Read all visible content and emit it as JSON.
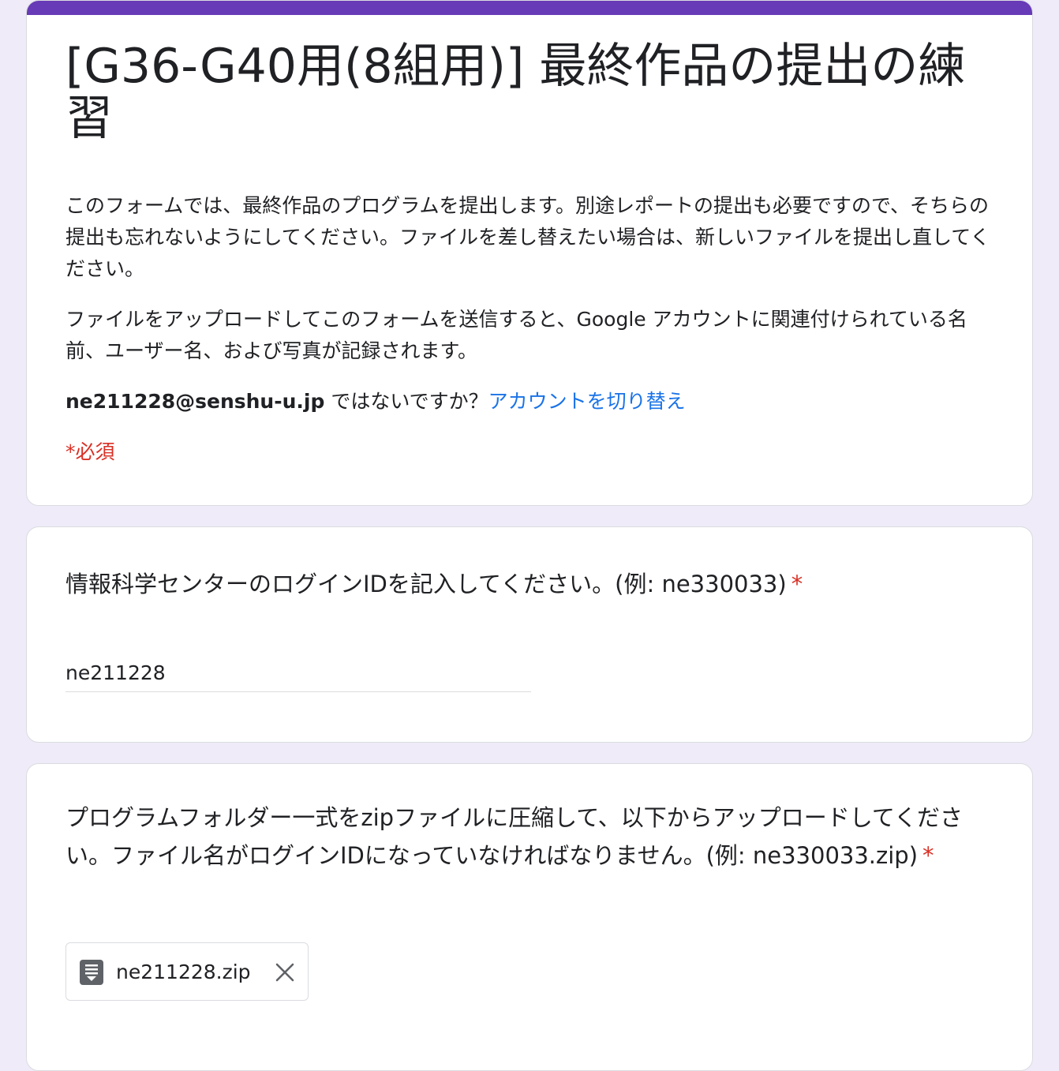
{
  "form": {
    "title": "[G36-G40用(8組用)] 最終作品の提出の練習",
    "description_1": "このフォームでは、最終作品のプログラムを提出します。別途レポートの提出も必要ですので、そちらの提出も忘れないようにしてください。ファイルを差し替えたい場合は、新しいファイルを提出し直してください。",
    "description_2": "ファイルをアップロードしてこのフォームを送信すると、Google アカウントに関連付けられている名前、ユーザー名、および写真が記録されます。",
    "account_email": "ne211228@senshu-u.jp",
    "account_question": " ではないですか？",
    "switch_account_label": "アカウントを切り替え",
    "required_note": "*必須",
    "accent_color": "#673ab7",
    "required_color": "#d93025",
    "link_color": "#1a73e8"
  },
  "questions": [
    {
      "label": "情報科学センターのログインIDを記入してください。(例: ne330033)",
      "required_mark": "*",
      "answer_value": "ne211228"
    },
    {
      "label": "プログラムフォルダー一式をzipファイルに圧縮して、以下からアップロードしてください。ファイル名がログインIDになっていなければなりません。(例: ne330033.zip)",
      "required_mark": "*",
      "uploaded_file": {
        "name": "ne211228.zip",
        "icon": "archive-file-icon",
        "remove_icon": "close-icon"
      }
    }
  ]
}
